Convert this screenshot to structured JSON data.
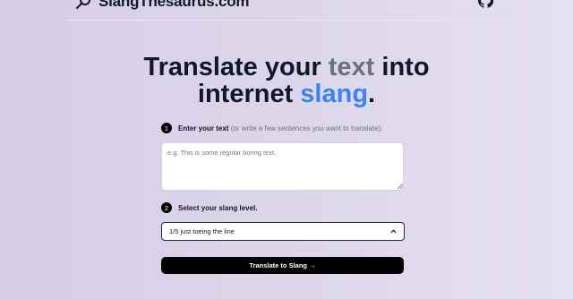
{
  "header": {
    "logo_text": "SlangThesaurus.com",
    "logo_icon": "magnifier-icon",
    "github_icon": "github-icon"
  },
  "headline": {
    "part1": "Translate your ",
    "part2": "text",
    "part3": " into",
    "part4": "internet ",
    "part5": "slang",
    "part6": "."
  },
  "step1": {
    "number": "1",
    "label": "Enter your text",
    "hint": " (or write a few sentences you want to translate)."
  },
  "textarea": {
    "placeholder": "e.g. This is some regular boring text.",
    "value": ""
  },
  "step2": {
    "number": "2",
    "label": "Select your slang level."
  },
  "slang_select": {
    "selected": "1/5 just toeing the line"
  },
  "submit_button": {
    "label": "Translate to Slang →"
  },
  "colors": {
    "accent": "#3b82f6",
    "muted": "#6b7280",
    "button": "#000000"
  }
}
